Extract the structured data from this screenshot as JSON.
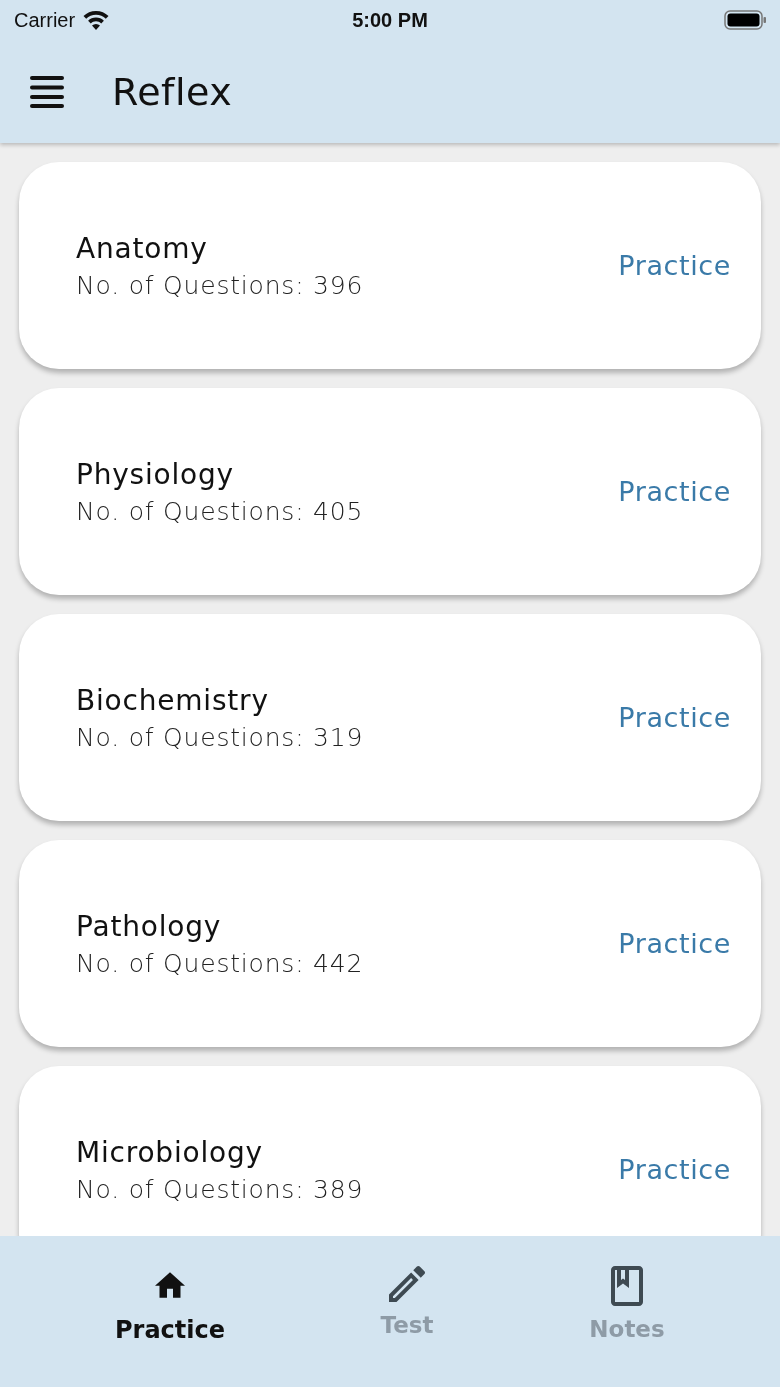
{
  "status_bar": {
    "carrier": "Carrier",
    "time": "5:00 PM"
  },
  "app_bar": {
    "title": "Reflex"
  },
  "subjects": [
    {
      "name": "Anatomy",
      "question_count": "No. of Questions: 396",
      "action": "Practice"
    },
    {
      "name": "Physiology",
      "question_count": "No. of Questions: 405",
      "action": "Practice"
    },
    {
      "name": "Biochemistry",
      "question_count": "No. of Questions: 319",
      "action": "Practice"
    },
    {
      "name": "Pathology",
      "question_count": "No. of Questions: 442",
      "action": "Practice"
    },
    {
      "name": "Microbiology",
      "question_count": "No. of Questions: 389",
      "action": "Practice"
    }
  ],
  "bottom_nav": [
    {
      "label": "Practice",
      "kind": "home",
      "selected": true
    },
    {
      "label": "Test",
      "kind": "pencil",
      "selected": false
    },
    {
      "label": "Notes",
      "kind": "book",
      "selected": false
    }
  ]
}
